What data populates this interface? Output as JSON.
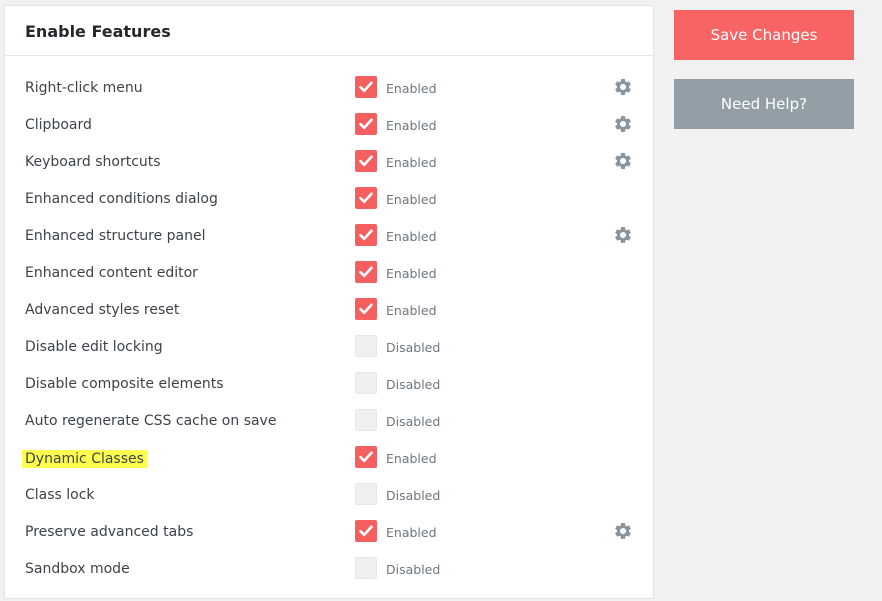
{
  "panel": {
    "title": "Enable Features"
  },
  "features": [
    {
      "label": "Right-click menu",
      "enabled": true,
      "status": "Enabled",
      "settings": true
    },
    {
      "label": "Clipboard",
      "enabled": true,
      "status": "Enabled",
      "settings": true
    },
    {
      "label": "Keyboard shortcuts",
      "enabled": true,
      "status": "Enabled",
      "settings": true
    },
    {
      "label": "Enhanced conditions dialog",
      "enabled": true,
      "status": "Enabled",
      "settings": false
    },
    {
      "label": "Enhanced structure panel",
      "enabled": true,
      "status": "Enabled",
      "settings": true
    },
    {
      "label": "Enhanced content editor",
      "enabled": true,
      "status": "Enabled",
      "settings": false
    },
    {
      "label": "Advanced styles reset",
      "enabled": true,
      "status": "Enabled",
      "settings": false
    },
    {
      "label": "Disable edit locking",
      "enabled": false,
      "status": "Disabled",
      "settings": false
    },
    {
      "label": "Disable composite elements",
      "enabled": false,
      "status": "Disabled",
      "settings": false
    },
    {
      "label": "Auto regenerate CSS cache on save",
      "enabled": false,
      "status": "Disabled",
      "settings": false
    },
    {
      "label": "Dynamic Classes",
      "enabled": true,
      "status": "Enabled",
      "settings": false,
      "highlighted": true
    },
    {
      "label": "Class lock",
      "enabled": false,
      "status": "Disabled",
      "settings": false
    },
    {
      "label": "Preserve advanced tabs",
      "enabled": true,
      "status": "Enabled",
      "settings": true
    },
    {
      "label": "Sandbox mode",
      "enabled": false,
      "status": "Disabled",
      "settings": false
    }
  ],
  "actions": {
    "save_label": "Save Changes",
    "help_label": "Need Help?"
  },
  "colors": {
    "accent": "#f86363",
    "checkbox_on": "#f55f5f",
    "checkbox_off": "#eef0f2",
    "help_button": "#939fa7",
    "gear": "#8a959e",
    "highlight": "#ffff4d"
  },
  "icons": {
    "checkbox_on": "checkmark-icon",
    "settings": "gear-icon"
  }
}
